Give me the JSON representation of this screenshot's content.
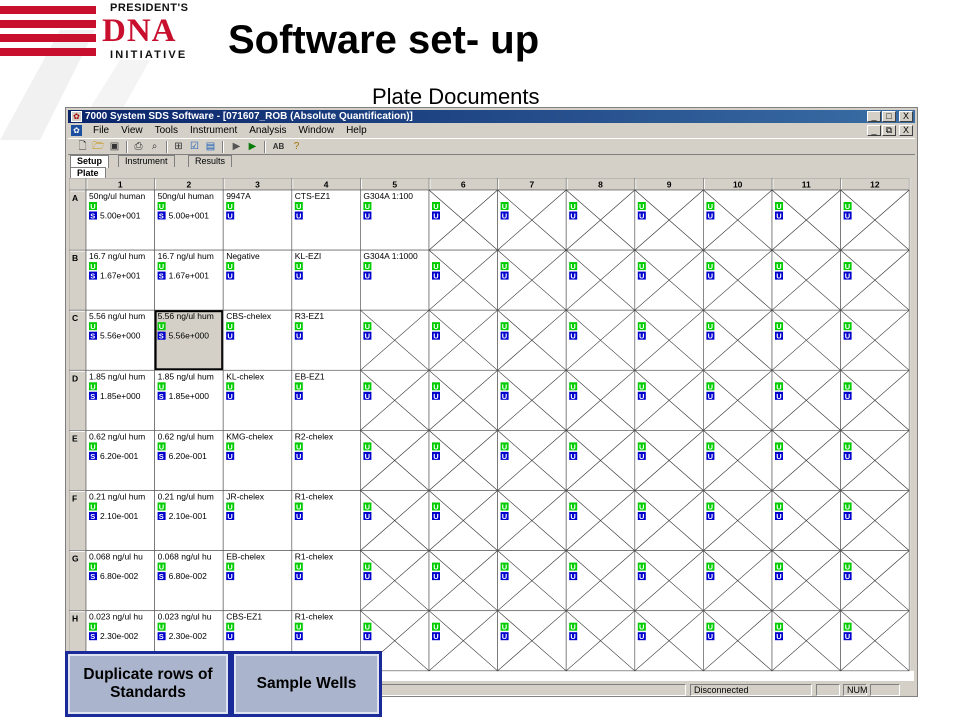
{
  "slide": {
    "title": "Software set- up",
    "subtitle": "Plate Documents",
    "logo": {
      "line1": "PRESIDENT'S",
      "line2": "DNA",
      "line3": "INITIATIVE"
    }
  },
  "window": {
    "title": "7000 System SDS Software - [071607_ROB (Absolute Quantification)]",
    "title_buttons": [
      "_",
      "□",
      "X"
    ],
    "doc_buttons": [
      "_",
      "⧉",
      "X"
    ]
  },
  "menu": [
    "File",
    "View",
    "Tools",
    "Instrument",
    "Analysis",
    "Window",
    "Help"
  ],
  "toolbar_icons": [
    "new-icon",
    "open-icon",
    "save-icon",
    "print-icon",
    "print-preview-icon",
    "zoom-icon",
    "properties-icon",
    "detector-icon",
    "run-icon",
    "run-step-icon",
    "ab-icon",
    "help-icon"
  ],
  "tabs": [
    "Setup",
    "Instrument",
    "Results"
  ],
  "subtabs": [
    "Plate"
  ],
  "plate": {
    "columns": [
      "1",
      "2",
      "3",
      "4",
      "5",
      "6",
      "7",
      "8",
      "9",
      "10",
      "11",
      "12"
    ],
    "rows": [
      "A",
      "B",
      "C",
      "D",
      "E",
      "F",
      "G",
      "H"
    ],
    "task_colors": {
      "U_green": "#00cc00",
      "U_blue": "#0000cc",
      "S": "#0000cc"
    },
    "selected_well": "C2",
    "wells": {
      "A": [
        {
          "name": "50ng/ul human",
          "task": "S",
          "qty": "5.00e+001"
        },
        {
          "name": "50ng/ul human",
          "task": "S",
          "qty": "5.00e+001"
        },
        {
          "name": "9947A",
          "task": "U"
        },
        {
          "name": "CTS-EZ1",
          "task": "U"
        },
        {
          "name": "G304A 1:100",
          "task": "U"
        }
      ],
      "B": [
        {
          "name": "16.7 ng/ul hum",
          "task": "S",
          "qty": "1.67e+001"
        },
        {
          "name": "16.7 ng/ul hum",
          "task": "S",
          "qty": "1.67e+001"
        },
        {
          "name": "Negative",
          "task": "U"
        },
        {
          "name": "KL-EZI",
          "task": "U"
        },
        {
          "name": "G304A 1:1000",
          "task": "U"
        }
      ],
      "C": [
        {
          "name": "5.56 ng/ul hum",
          "task": "S",
          "qty": "5.56e+000"
        },
        {
          "name": "5.56 ng/ul hum",
          "task": "S",
          "qty": "5.56e+000"
        },
        {
          "name": "CBS-chelex",
          "task": "U"
        },
        {
          "name": "R3-EZ1",
          "task": "U"
        }
      ],
      "D": [
        {
          "name": "1.85 ng/ul hum",
          "task": "S",
          "qty": "1.85e+000"
        },
        {
          "name": "1.85 ng/ul hum",
          "task": "S",
          "qty": "1.85e+000"
        },
        {
          "name": "KL-chelex",
          "task": "U"
        },
        {
          "name": "EB-EZ1",
          "task": "U"
        }
      ],
      "E": [
        {
          "name": "0.62 ng/ul hum",
          "task": "S",
          "qty": "6.20e-001"
        },
        {
          "name": "0.62 ng/ul hum",
          "task": "S",
          "qty": "6.20e-001"
        },
        {
          "name": "KMG-chelex",
          "task": "U"
        },
        {
          "name": "R2-chelex",
          "task": "U"
        }
      ],
      "F": [
        {
          "name": "0.21 ng/ul hum",
          "task": "S",
          "qty": "2.10e-001"
        },
        {
          "name": "0.21 ng/ul hum",
          "task": "S",
          "qty": "2.10e-001"
        },
        {
          "name": "JR-chelex",
          "task": "U"
        },
        {
          "name": "R1-chelex",
          "task": "U"
        }
      ],
      "G": [
        {
          "name": "0.068 ng/ul hu",
          "task": "S",
          "qty": "6.80e-002"
        },
        {
          "name": "0.068 ng/ul hu",
          "task": "S",
          "qty": "6.80e-002"
        },
        {
          "name": "EB-chelex",
          "task": "U"
        },
        {
          "name": "R1-chelex",
          "task": "U"
        }
      ],
      "H": [
        {
          "name": "0.023 ng/ul hu",
          "task": "S",
          "qty": "2.30e-002"
        },
        {
          "name": "0.023 ng/ul hu",
          "task": "S",
          "qty": "2.30e-002"
        },
        {
          "name": "CBS-EZ1",
          "task": "U"
        },
        {
          "name": "R1-chelex",
          "task": "U"
        }
      ]
    },
    "detector_letter": "U",
    "standard_letter": "S"
  },
  "statusbar": {
    "connection": "Disconnected",
    "num": "NUM"
  },
  "callouts": {
    "standards": "Duplicate rows of Standards",
    "samples": "Sample Wells"
  }
}
